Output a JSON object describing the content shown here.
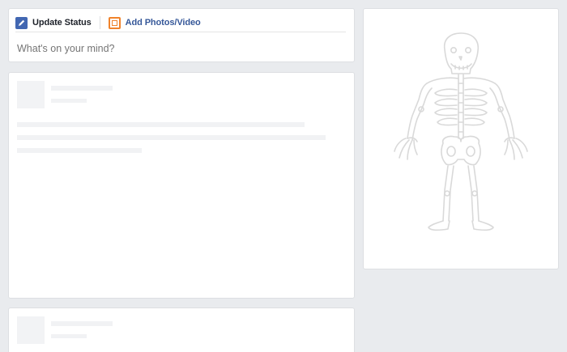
{
  "composer": {
    "tabs": [
      {
        "label": "Update Status",
        "icon": "pencil-icon"
      },
      {
        "label": "Add Photos/Video",
        "icon": "photo-icon"
      }
    ],
    "placeholder": "What's on your mind?"
  },
  "colors": {
    "background": "#e9ebee",
    "card": "#ffffff",
    "brand_blue": "#4267b2",
    "link_blue": "#365899",
    "orange": "#f0832b",
    "placeholder_gray": "#f1f2f4",
    "skeleton_stroke": "#dcdcdc"
  },
  "side_panel": {
    "illustration": "skeleton-illustration"
  }
}
